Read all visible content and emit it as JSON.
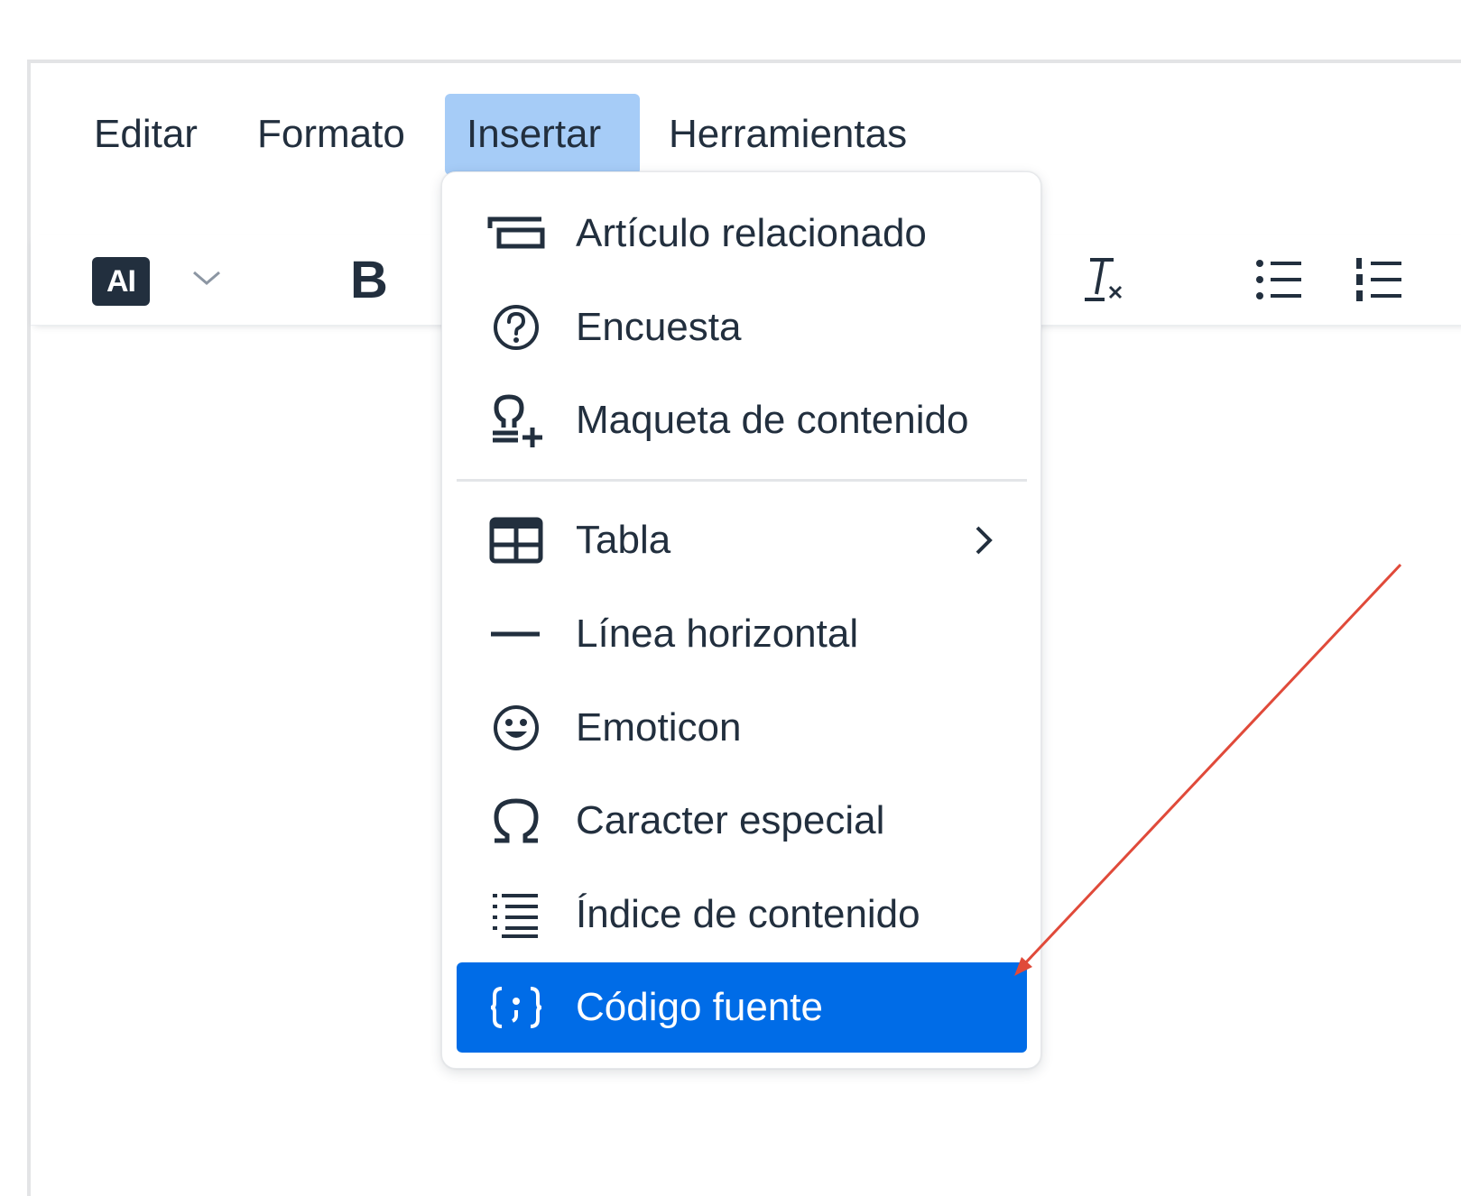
{
  "menubar": {
    "items": [
      {
        "label": "Editar"
      },
      {
        "label": "Formato"
      },
      {
        "label": "Insertar"
      },
      {
        "label": "Herramientas"
      }
    ]
  },
  "toolbar": {
    "ai_label": "AI",
    "bold_label": "B"
  },
  "insert_menu": {
    "items": [
      {
        "label": "Artículo relacionado",
        "icon": "related-article-icon"
      },
      {
        "label": "Encuesta",
        "icon": "question-circle-icon"
      },
      {
        "label": "Maqueta de contenido",
        "icon": "content-template-icon"
      },
      {
        "label": "Tabla",
        "icon": "table-icon",
        "has_submenu": true
      },
      {
        "label": "Línea horizontal",
        "icon": "horizontal-rule-icon"
      },
      {
        "label": "Emoticon",
        "icon": "emoji-icon"
      },
      {
        "label": "Caracter especial",
        "icon": "omega-icon"
      },
      {
        "label": "Índice de contenido",
        "icon": "toc-icon"
      },
      {
        "label": "Código fuente",
        "icon": "source-code-icon",
        "selected": true
      }
    ]
  },
  "colors": {
    "active_menu_bg": "#a6ccf7",
    "selected_item_bg": "#006ce7",
    "text": "#222f3e",
    "annotation_arrow": "#e04a3a"
  }
}
